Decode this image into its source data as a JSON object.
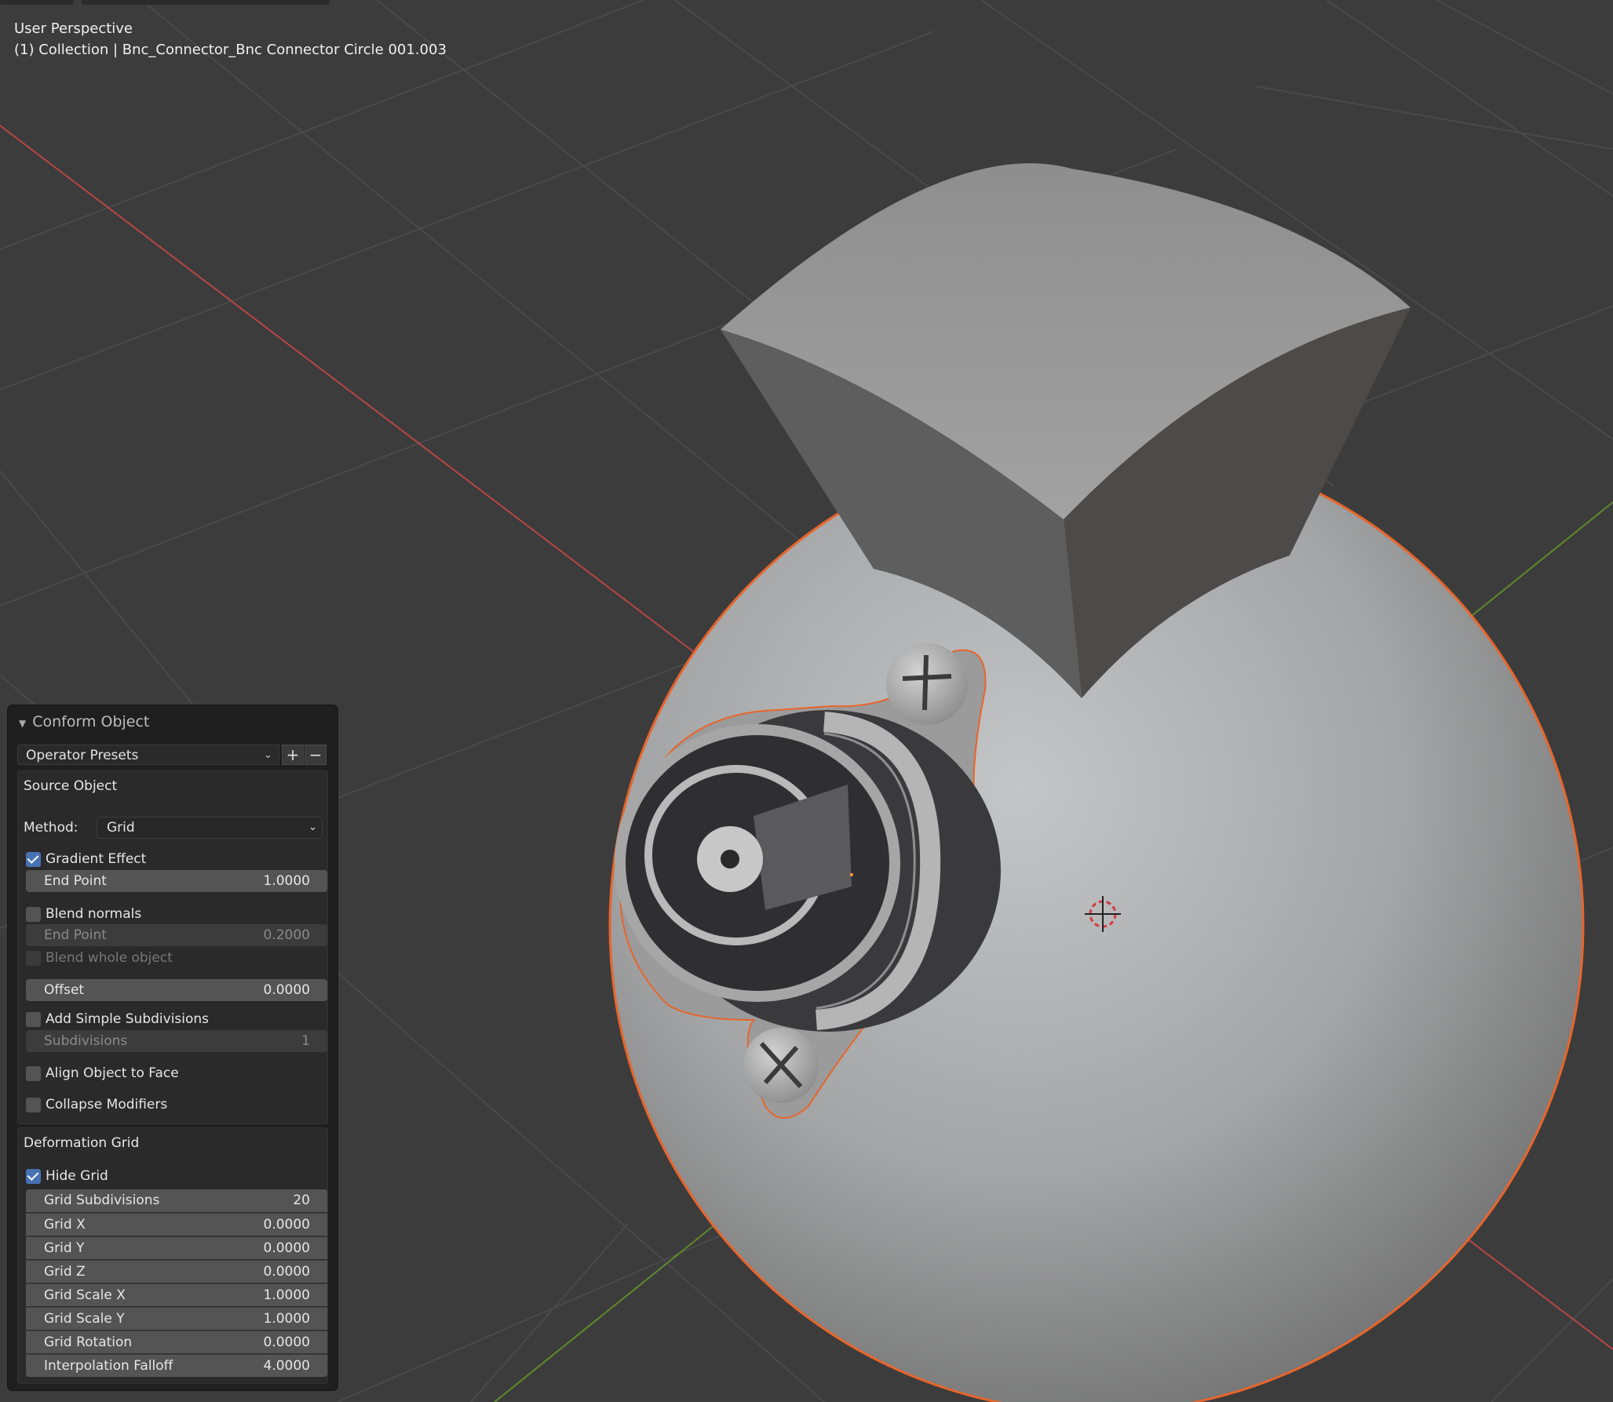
{
  "viewport": {
    "perspective_label": "User Perspective",
    "object_label": "(1) Collection | Bnc_Connector_Bnc Connector Circle 001.003",
    "selection_color": "#e8652b",
    "x_axis_color": "#c44a4a",
    "y_axis_color": "#6a9a2c"
  },
  "panel": {
    "title": "Conform Object",
    "presets": {
      "label": "Operator Presets",
      "add_symbol": "+",
      "remove_symbol": "−"
    },
    "source": {
      "title": "Source Object",
      "method_label": "Method:",
      "method_value": "Grid",
      "gradient_effect": {
        "label": "Gradient Effect",
        "checked": true
      },
      "end_point_1": {
        "label": "End Point",
        "value": "1.0000"
      },
      "blend_normals": {
        "label": "Blend normals",
        "checked": false
      },
      "end_point_2": {
        "label": "End Point",
        "value": "0.2000"
      },
      "blend_whole": {
        "label": "Blend whole object",
        "checked": false
      },
      "offset": {
        "label": "Offset",
        "value": "0.0000"
      },
      "add_subdiv": {
        "label": "Add Simple Subdivisions",
        "checked": false
      },
      "subdivisions": {
        "label": "Subdivisions",
        "value": "1"
      },
      "align_face": {
        "label": "Align Object to Face",
        "checked": false
      },
      "collapse_mods": {
        "label": "Collapse Modifiers",
        "checked": false
      }
    },
    "deformation": {
      "title": "Deformation Grid",
      "hide_grid": {
        "label": "Hide Grid",
        "checked": true
      },
      "rows": [
        {
          "label": "Grid Subdivisions",
          "value": "20"
        },
        {
          "label": "Grid X",
          "value": "0.0000"
        },
        {
          "label": "Grid Y",
          "value": "0.0000"
        },
        {
          "label": "Grid Z",
          "value": "0.0000"
        },
        {
          "label": "Grid Scale X",
          "value": "1.0000"
        },
        {
          "label": "Grid Scale Y",
          "value": "1.0000"
        },
        {
          "label": "Grid Rotation",
          "value": "0.0000"
        },
        {
          "label": "Interpolation Falloff",
          "value": "4.0000"
        }
      ]
    }
  }
}
